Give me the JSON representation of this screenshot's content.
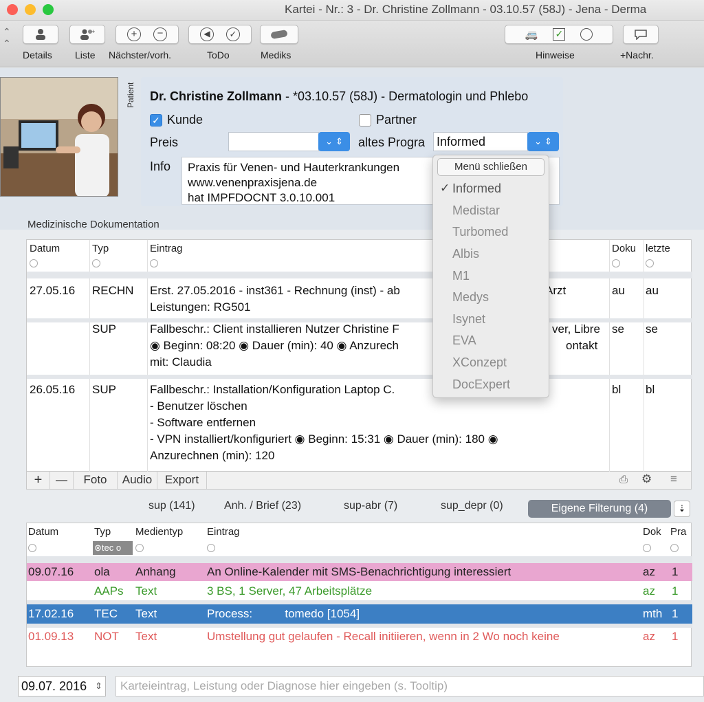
{
  "window": {
    "title": "Kartei - Nr.: 3 - Dr. Christine Zollmann - 03.10.57 (58J) - Jena - Derma"
  },
  "colors": {
    "accent": "#3b8ee6",
    "pink_row": "#e9a6d0",
    "green_text": "#3a9a2a",
    "red_text": "#e05a5a",
    "selected": "#3c7fc4"
  },
  "toolbar": {
    "details": "Details",
    "liste": "Liste",
    "naechster": "Nächster/vorh.",
    "todo": "ToDo",
    "mediks": "Mediks",
    "hinweise": "Hinweise",
    "nachr": "+Nachr."
  },
  "patient": {
    "section_label": "Patient",
    "name": "Dr. Christine Zollmann",
    "details": " - *03.10.57 (58J) - Dermatologin und Phlebo",
    "kunde_label": "Kunde",
    "kunde_checked": true,
    "partner_label": "Partner",
    "partner_checked": false,
    "preis_label": "Preis",
    "preis_value": "",
    "altes_label": "altes Progra",
    "altes_value": "Informed",
    "info_label": "Info",
    "info_lines": [
      "Praxis für Venen- und Hauterkrankungen",
      "www.venenpraxisjena.de",
      "hat IMPFDOCNT 3.0.10.001"
    ]
  },
  "dropdown": {
    "close_label": "Menü schließen",
    "options": [
      "Informed",
      "Medistar",
      "Turbomed",
      "Albis",
      "M1",
      "Medys",
      "Isynet",
      "EVA",
      "XConzept",
      "DocExpert"
    ],
    "selected": "Informed",
    "check": "✓"
  },
  "doc": {
    "section_title": "Medizinische Dokumentation",
    "headers": [
      "Datum",
      "Typ",
      "Eintrag",
      "Doku",
      "letzte"
    ],
    "rows": [
      {
        "date": "27.05.16",
        "type": "RECHN",
        "lines": [
          "Erst. 27.05.2016 - inst361 - Rechnung (inst) - ab",
          "Leistungen: RG501"
        ],
        "tail": "Arzt",
        "doku": "au",
        "letzte": "au"
      },
      {
        "date": "",
        "type": "SUP",
        "lines": [
          "Fallbeschr.: Client installieren Nutzer Christine F",
          "◉ Beginn: 08:20 ◉ Dauer (min): 40 ◉ Anzurech",
          "mit: Claudia"
        ],
        "tail": "ver, Libre",
        "tail2": "ontakt",
        "doku": "se",
        "letzte": "se"
      },
      {
        "date": "26.05.16",
        "type": "SUP",
        "lines": [
          "Fallbeschr.: Installation/Konfiguration Laptop C.",
          "- Benutzer löschen",
          "- Software entfernen",
          "- VPN installiert/konfiguriert ◉ Beginn: 15:31 ◉ Dauer (min): 180 ◉",
          "Anzurechnen (min): 120"
        ],
        "doku": "bl",
        "letzte": "bl"
      }
    ],
    "footer": {
      "plus": "+",
      "minus": "—",
      "foto": "Foto",
      "audio": "Audio",
      "export": "Export"
    }
  },
  "filters": {
    "tabs": [
      "sup (141)",
      "Anh. / Brief (23)",
      "sup-abr (7)",
      "sup_depr (0)"
    ],
    "active": "Eigene Filterung (4)"
  },
  "media": {
    "headers": [
      "Datum",
      "Typ",
      "Medientyp",
      "Eintrag",
      "Dok",
      "Pra"
    ],
    "typ_filter": "tec o",
    "rows": [
      {
        "date": "09.07.16",
        "typ": "ola",
        "medientyp": "Anhang",
        "eintrag": "An Online-Kalender mit SMS-Benachrichtigung interessiert",
        "dok": "az",
        "pra": "1",
        "style": "pink"
      },
      {
        "date": "",
        "typ": "AAPs",
        "medientyp": "Text",
        "eintrag": "3 BS, 1 Server, 47 Arbeitsplätze",
        "dok": "az",
        "pra": "1",
        "style": "green"
      },
      {
        "date": "17.02.16",
        "typ": "TEC",
        "medientyp": "Text",
        "eintrag": "Process:          tomedo [1054]",
        "dok": "mth",
        "pra": "1",
        "style": "selected"
      },
      {
        "date": "01.09.13",
        "typ": "NOT",
        "medientyp": "Text",
        "eintrag": "Umstellung gut gelaufen - Recall initiieren, wenn in 2 Wo noch keine",
        "dok": "az",
        "pra": "1",
        "style": "red"
      }
    ]
  },
  "bottom": {
    "date": "09.07. 2016",
    "placeholder": "Karteieintrag, Leistung oder Diagnose hier eingeben (s. Tooltip)"
  }
}
